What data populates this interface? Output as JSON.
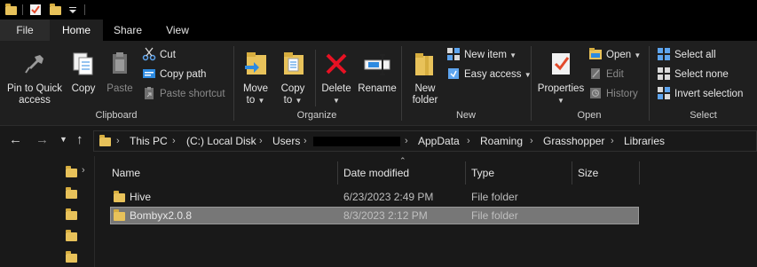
{
  "ribbon_tabs": [
    "File",
    "Home",
    "Share",
    "View"
  ],
  "clipboard": {
    "pin_label_1": "Pin to Quick",
    "pin_label_2": "access",
    "copy": "Copy",
    "paste": "Paste",
    "cut": "Cut",
    "copy_path": "Copy path",
    "paste_shortcut": "Paste shortcut",
    "group": "Clipboard"
  },
  "organize": {
    "move_to_1": "Move",
    "move_to_2": "to",
    "copy_to_1": "Copy",
    "copy_to_2": "to",
    "delete": "Delete",
    "rename": "Rename",
    "group": "Organize"
  },
  "new": {
    "new_folder_1": "New",
    "new_folder_2": "folder",
    "new_item": "New item",
    "easy_access": "Easy access",
    "group": "New"
  },
  "open": {
    "properties": "Properties",
    "open": "Open",
    "edit": "Edit",
    "history": "History",
    "group": "Open"
  },
  "select": {
    "select_all": "Select all",
    "select_none": "Select none",
    "invert": "Invert selection",
    "group": "Select"
  },
  "breadcrumb": [
    "This PC",
    "(C:) Local Disk",
    "Users",
    "AppData",
    "Roaming",
    "Grasshopper",
    "Libraries"
  ],
  "columns": [
    "Name",
    "Date modified",
    "Type",
    "Size"
  ],
  "files": [
    {
      "name": "Hive",
      "date": "6/23/2023 2:49 PM",
      "type": "File folder"
    },
    {
      "name": "Bombyx2.0.8",
      "date": "8/3/2023 2:12 PM",
      "type": "File folder"
    }
  ],
  "colors": {
    "folder": "#e8c25a",
    "ribbon_bg": "#1f1f1f",
    "selected_row": "#777777",
    "delete_red": "#e81123",
    "accent_blue": "#2d8ae0"
  }
}
